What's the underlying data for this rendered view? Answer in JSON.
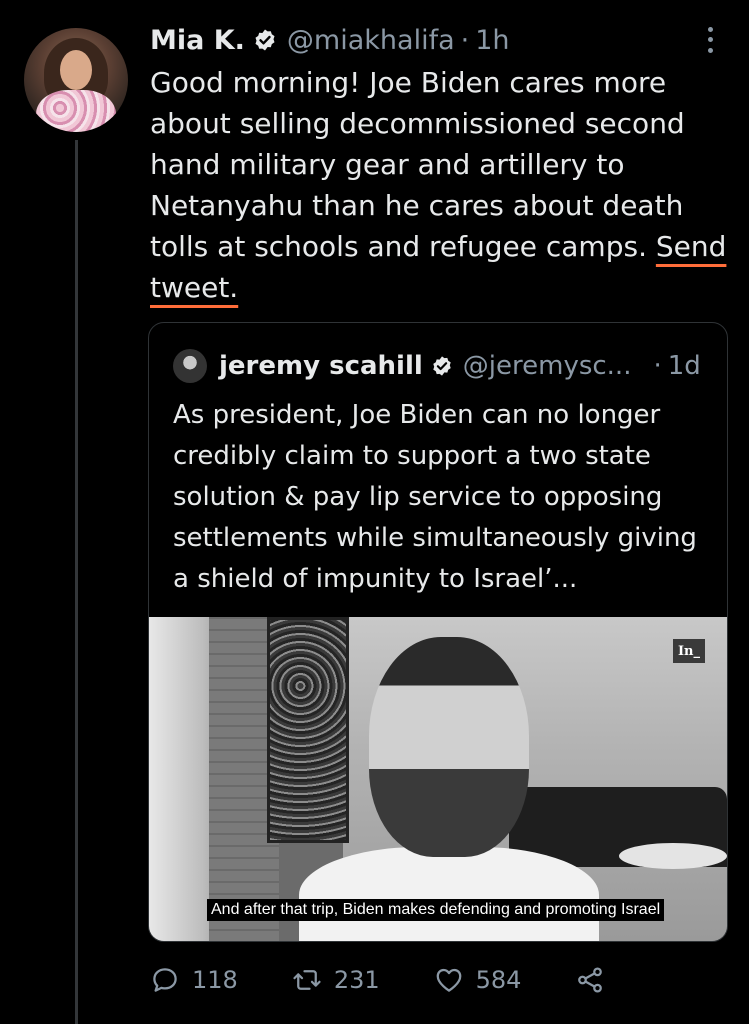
{
  "tweet": {
    "author_name": "Mia K.",
    "handle": "@miakhalifa",
    "separator": "·",
    "time": "1h",
    "text_main": "Good morning! Joe Biden cares more about selling decommissioned second hand military gear and artillery to Netanyahu than he cares about death tolls at schools and refugee camps. ",
    "text_underlined": "Send tweet."
  },
  "quote": {
    "author_name": "jeremy scahill",
    "handle": "@jeremysc...",
    "separator": "·",
    "time": "1d",
    "text": "As president, Joe Biden can no longer credibly claim to support a two state solution & pay lip service to opposing settlements while simultaneously giving a shield of impunity to Israel’...",
    "media_logo": "In_",
    "subtitle": "And after that trip, Biden makes defending and promoting Israel"
  },
  "actions": {
    "reply_count": "118",
    "retweet_count": "231",
    "like_count": "584"
  },
  "colors": {
    "background": "#000000",
    "text": "#e7e9ea",
    "secondary_text": "#8b98a5",
    "verified": "#e7e9ea",
    "underline": "#ff6d3a"
  },
  "icons": {
    "verified": "verified-badge-icon",
    "more": "more-vertical-icon",
    "reply": "reply-icon",
    "retweet": "retweet-icon",
    "like": "heart-icon",
    "share": "share-icon"
  }
}
